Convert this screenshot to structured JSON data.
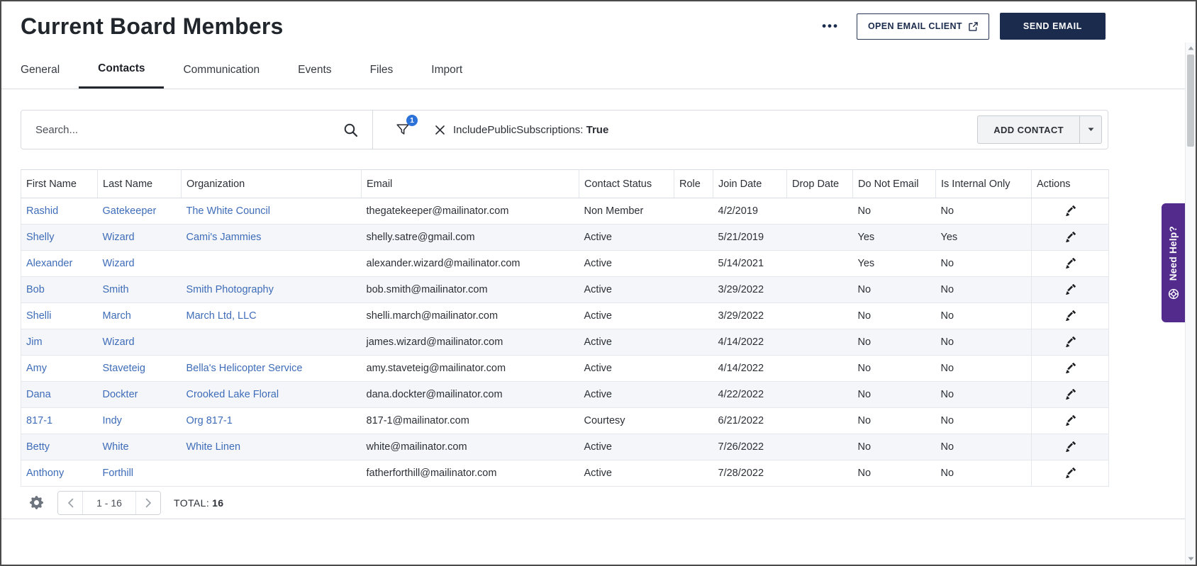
{
  "page": {
    "title": "Current Board Members"
  },
  "header": {
    "more_label": "•••",
    "open_email_client_label": "OPEN EMAIL CLIENT",
    "send_email_label": "SEND EMAIL"
  },
  "tabs": [
    {
      "label": "General",
      "active": false
    },
    {
      "label": "Contacts",
      "active": true
    },
    {
      "label": "Communication",
      "active": false
    },
    {
      "label": "Events",
      "active": false
    },
    {
      "label": "Files",
      "active": false
    },
    {
      "label": "Import",
      "active": false
    }
  ],
  "toolbar": {
    "search_placeholder": "Search...",
    "filter_count": "1",
    "filter_label": "IncludePublicSubscriptions:",
    "filter_value": "True",
    "add_contact_label": "ADD CONTACT"
  },
  "table": {
    "columns": [
      "First Name",
      "Last Name",
      "Organization",
      "Email",
      "Contact Status",
      "Role",
      "Join Date",
      "Drop Date",
      "Do Not Email",
      "Is Internal Only",
      "Actions"
    ],
    "rows": [
      [
        "Rashid",
        "Gatekeeper",
        "The White Council",
        "thegatekeeper@mailinator.com",
        "Non Member",
        "",
        "4/2/2019",
        "",
        "No",
        "No"
      ],
      [
        "Shelly",
        "Wizard",
        "Cami's Jammies",
        "shelly.satre@gmail.com",
        "Active",
        "",
        "5/21/2019",
        "",
        "Yes",
        "Yes"
      ],
      [
        "Alexander",
        "Wizard",
        "",
        "alexander.wizard@mailinator.com",
        "Active",
        "",
        "5/14/2021",
        "",
        "Yes",
        "No"
      ],
      [
        "Bob",
        "Smith",
        "Smith Photography",
        "bob.smith@mailinator.com",
        "Active",
        "",
        "3/29/2022",
        "",
        "No",
        "No"
      ],
      [
        "Shelli",
        "March",
        "March Ltd, LLC",
        "shelli.march@mailinator.com",
        "Active",
        "",
        "3/29/2022",
        "",
        "No",
        "No"
      ],
      [
        "Jim",
        "Wizard",
        "",
        "james.wizard@mailinator.com",
        "Active",
        "",
        "4/14/2022",
        "",
        "No",
        "No"
      ],
      [
        "Amy",
        "Staveteig",
        "Bella's Helicopter Service",
        "amy.staveteig@mailinator.com",
        "Active",
        "",
        "4/14/2022",
        "",
        "No",
        "No"
      ],
      [
        "Dana",
        "Dockter",
        "Crooked Lake Floral",
        "dana.dockter@mailinator.com",
        "Active",
        "",
        "4/22/2022",
        "",
        "No",
        "No"
      ],
      [
        "817-1",
        "Indy",
        "Org 817-1",
        "817-1@mailinator.com",
        "Courtesy",
        "",
        "6/21/2022",
        "",
        "No",
        "No"
      ],
      [
        "Betty",
        "White",
        "White Linen",
        "white@mailinator.com",
        "Active",
        "",
        "7/26/2022",
        "",
        "No",
        "No"
      ],
      [
        "Anthony",
        "Forthill",
        "",
        "fatherforthill@mailinator.com",
        "Active",
        "",
        "7/28/2022",
        "",
        "No",
        "No"
      ]
    ]
  },
  "footer": {
    "page_range": "1 - 16",
    "total_label": "TOTAL:",
    "total_value": "16"
  },
  "help_tab": {
    "label": "Need Help?"
  },
  "colors": {
    "link": "#3e6cb8",
    "accent_navy": "#1b2b4d",
    "badge_blue": "#2b72d9",
    "help_purple": "#532b8d",
    "row_alt": "#f4f6fa"
  }
}
